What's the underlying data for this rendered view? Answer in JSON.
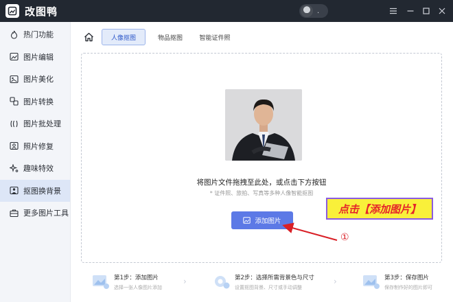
{
  "app": {
    "title": "改图鸭",
    "user_name": "."
  },
  "sidebar": {
    "items": [
      {
        "label": "热门功能",
        "icon": "flame-icon"
      },
      {
        "label": "图片编辑",
        "icon": "image-edit-icon"
      },
      {
        "label": "图片美化",
        "icon": "image-beautify-icon"
      },
      {
        "label": "图片转换",
        "icon": "convert-icon"
      },
      {
        "label": "图片批处理",
        "icon": "batch-icon"
      },
      {
        "label": "照片修复",
        "icon": "photo-repair-icon"
      },
      {
        "label": "趣味特效",
        "icon": "sparkle-icon"
      },
      {
        "label": "抠图换背景",
        "icon": "cutout-icon",
        "active": true
      },
      {
        "label": "更多图片工具",
        "icon": "toolbox-icon"
      }
    ]
  },
  "tabs": [
    {
      "label": "人像抠图",
      "active": true
    },
    {
      "label": "物品抠图"
    },
    {
      "label": "智能证件照"
    }
  ],
  "dropzone": {
    "title": "将图片文件拖拽至此处，或点击下方按钮",
    "subtitle": "* 证件照、旅拍、写真等多种人像智能抠图",
    "button_label": "添加图片"
  },
  "annotation": {
    "callout": "点击【添加图片】",
    "marker": "①"
  },
  "steps": [
    {
      "title": "第1步：添加图片",
      "desc": "选择一张人像图片添加"
    },
    {
      "title": "第2步：选择所需背景色与尺寸",
      "desc": "设置抠图背景、尺寸或手动调整"
    },
    {
      "title": "第3步：保存图片",
      "desc": "保存制作好的图片即可"
    }
  ],
  "colors": {
    "accent": "#5c79e6",
    "titlebar": "#222831",
    "callout_bg": "#f9f03a",
    "callout_text": "#e5252a"
  }
}
